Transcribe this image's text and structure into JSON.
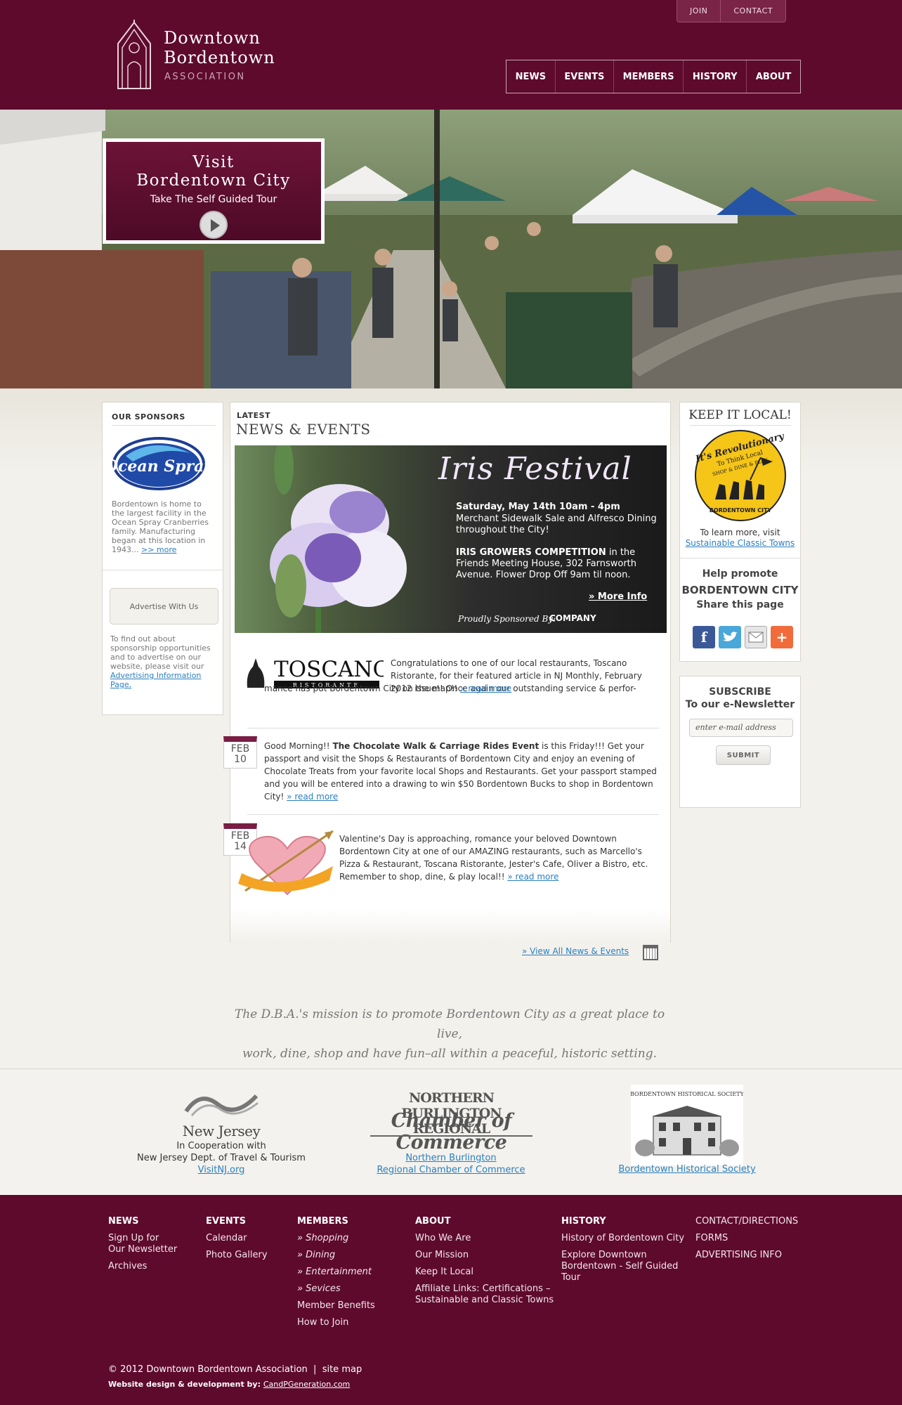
{
  "header": {
    "logo_line1": "Downtown",
    "logo_line2": "Bordentown",
    "logo_line3": "ASSOCIATION",
    "utility": [
      "JOIN",
      "CONTACT"
    ],
    "nav": [
      "NEWS",
      "EVENTS",
      "MEMBERS",
      "HISTORY",
      "ABOUT"
    ]
  },
  "hero": {
    "visit_line1": "Visit",
    "visit_line2": "Bordentown City",
    "visit_subtitle": "Take The Self Guided Tour"
  },
  "sponsors": {
    "title": "OUR SPONSORS",
    "logo_text": "Ocean Spray",
    "text": "Bordentown is home to the largest facility in the Ocean Spray Cranberries family. Manufacturing began at this location in 1943... ",
    "more": ">> more",
    "advertise_button": "Advertise With Us",
    "advertise_text": "To find out about sponsorship opportunities and to advertise on our website, please visit our ",
    "advertise_link": "Advertising Information Page."
  },
  "news": {
    "latest": "LATEST",
    "title": "NEWS & EVENTS",
    "iris": {
      "title": "Iris Festival",
      "date": "Saturday, May 14th 10am - 4pm",
      "line1": "Merchant Sidewalk Sale and Alfresco Dining throughout the City!",
      "competition": "IRIS GROWERS COMPETITION",
      "line2": " in the Friends Meeting House, 302 Farnsworth Avenue. Flower Drop Off 9am til noon.",
      "more": "» More Info",
      "sponsored_by": "Proudly Sponsored By:",
      "company": "COMPANY"
    },
    "toscano": {
      "logo_text": "TOSCANO",
      "logo_sub": "RISTORANTE",
      "text1": "Congratulations to one of our local restaurants, Toscano Ristorante, for their featured article in NJ Monthly, February 2012 issue!! Once again our outstanding service & perfor-",
      "text2": "mance has put Bordentown City on the map!! ",
      "read_more": "» read more"
    },
    "chocolate": {
      "month": "FEB",
      "day": "10",
      "intro": "Good Morning!! ",
      "event": "The Chocolate Walk & Carriage Rides Event",
      "text": " is this Friday!!! Get your passport and visit the Shops & Restaurants of Bordentown City and enjoy an evening of Chocolate Treats from your favorite local Shops and Restaurants. Get your passport stamped and you will be entered into a drawing to win $50 Bordentown Bucks to shop in Bordentown City! ",
      "read_more": "» read more"
    },
    "valentine": {
      "month": "FEB",
      "day": "14",
      "text": "Valentine's Day is approaching, romance your beloved Downtown Bordentown City at one of our AMAZING restaurants, such as Marcello's Pizza & Restaurant, Toscana Ristorante, Jester's Cafe, Oliver a Bistro, etc. Remember to shop, dine, & play local!! ",
      "read_more": "» read more"
    },
    "view_all": "» View All News & Events"
  },
  "keep_local": {
    "title": "KEEP IT LOCAL!",
    "badge_top": "It's Revolutionary",
    "badge_mid1": "To Think Local",
    "badge_mid2": "SHOP & DINE & PLAY",
    "badge_bottom": "BORDENTOWN CITY",
    "learn": "To learn more, visit",
    "link": "Sustainable Classic Towns",
    "help1": "Help promote",
    "help2": "BORDENTOWN CITY",
    "help3": "Share this page"
  },
  "subscribe": {
    "line1": "SUBSCRIBE",
    "line2": "To our e-Newsletter",
    "placeholder": "enter e-mail address",
    "submit": "SUBMIT"
  },
  "mission": {
    "line1": "The D.B.A.'s mission is to promote Bordentown City as a great place to live,",
    "line2": "work, dine, shop and have fun–all within a peaceful, historic setting."
  },
  "partners": {
    "nj_wordmark": "New Jersey",
    "nj_line1": "In Cooperation with",
    "nj_line2": "New Jersey Dept. of Travel & Tourism",
    "nj_link": "VisitNJ.org",
    "cc_logo_line1": "NORTHERN BURLINGTON REGIONAL",
    "cc_logo_line2": "Chamber of Commerce",
    "cc_link1": "Northern Burlington",
    "cc_link2": "Regional Chamber of Commerce",
    "hs_logo_text": "BORDENTOWN HISTORICAL SOCIETY",
    "hs_link": "Bordentown Historical Society"
  },
  "footer": {
    "news": {
      "heading": "NEWS",
      "items": [
        "Sign Up for",
        "Our Newsletter",
        "Archives"
      ]
    },
    "events": {
      "heading": "EVENTS",
      "items": [
        "Calendar",
        "Photo Gallery"
      ]
    },
    "members": {
      "heading": "MEMBERS",
      "items": [
        "Shopping",
        "Dining",
        "Entertainment",
        "Sevices",
        "Member Benefits",
        "How to Join"
      ]
    },
    "about": {
      "heading": "ABOUT",
      "items": [
        "Who We Are",
        "Our Mission",
        "Keep It Local",
        "Affiliate Links: Certifications –",
        "Sustainable and Classic Towns"
      ]
    },
    "history": {
      "heading": "HISTORY",
      "items": [
        "History of Bordentown City",
        "Explore Downtown",
        "Bordentown - Self Guided",
        "Tour"
      ]
    },
    "misc": [
      "CONTACT/DIRECTIONS",
      "FORMS",
      "ADVERTISING INFO"
    ],
    "copyright": "© 2012 Downtown Bordentown Association  |  site map",
    "credit_label": "Website design & development by: ",
    "credit_link": "CandPGeneration.com"
  },
  "colors": {
    "brand": "#5e0a2d",
    "link": "#2a7fc0",
    "badge": "#7a1d44"
  }
}
